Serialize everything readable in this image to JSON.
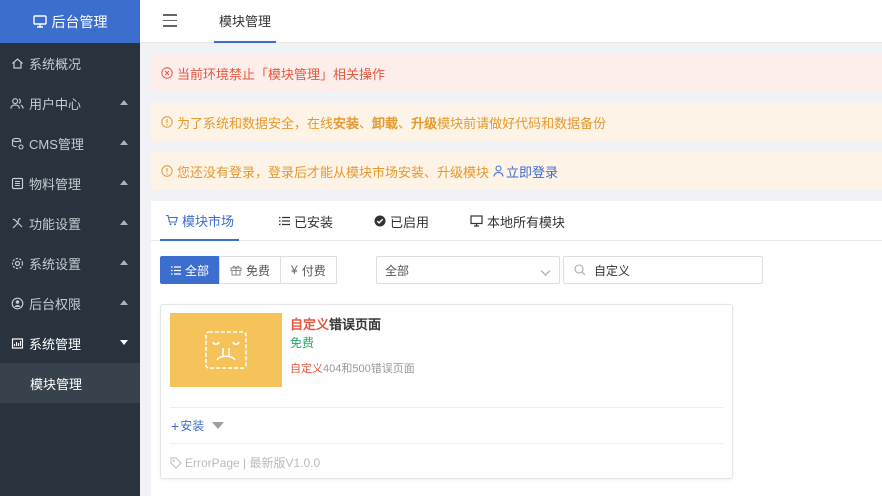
{
  "sidebar": {
    "brand": "后台管理",
    "items": [
      {
        "label": "系统概况",
        "icon": "home-icon",
        "caret": false
      },
      {
        "label": "用户中心",
        "icon": "users-icon",
        "caret": true
      },
      {
        "label": "CMS管理",
        "icon": "cms-icon",
        "caret": true
      },
      {
        "label": "物料管理",
        "icon": "list-icon",
        "caret": true
      },
      {
        "label": "功能设置",
        "icon": "tools-icon",
        "caret": true
      },
      {
        "label": "系统设置",
        "icon": "gear-icon",
        "caret": true
      },
      {
        "label": "后台权限",
        "icon": "user-circle-icon",
        "caret": true
      },
      {
        "label": "系统管理",
        "icon": "chart-icon",
        "caret": true
      }
    ],
    "sub_item": "模块管理"
  },
  "topbar": {
    "tab": "模块管理"
  },
  "alerts": {
    "error": "当前环境禁止「模块管理」相关操作",
    "warn1": {
      "pre": "为了系统和数据安全，在线 ",
      "b1": "安装",
      "sep1": "、",
      "b2": "卸载",
      "sep2": "、",
      "b3": "升级",
      "post": " 模块前请做好代码和数据备份"
    },
    "warn2": {
      "text": "您还没有登录，登录后才能从模块市场安装、升级模块",
      "link": "立即登录"
    }
  },
  "tabs": [
    "模块市场",
    "已安装",
    "已启用",
    "本地所有模块"
  ],
  "filters": {
    "buttons": [
      "全部",
      "免费",
      "付费"
    ],
    "select_value": "全部",
    "search_value": "自定义"
  },
  "card": {
    "title_hl": "自定义",
    "title_rest": "错误页面",
    "price": "免费",
    "desc_hl": "自定义",
    "desc_rest": "404和500错误页面",
    "install": "安装",
    "meta": "ErrorPage | 最新版V1.0.0"
  },
  "colors": {
    "primary": "#3c6ecd",
    "sidebar_bg": "#28333e",
    "error": "#e5583f",
    "warning": "#e59a2f",
    "free": "#25a768",
    "thumb": "#f6c35b"
  }
}
